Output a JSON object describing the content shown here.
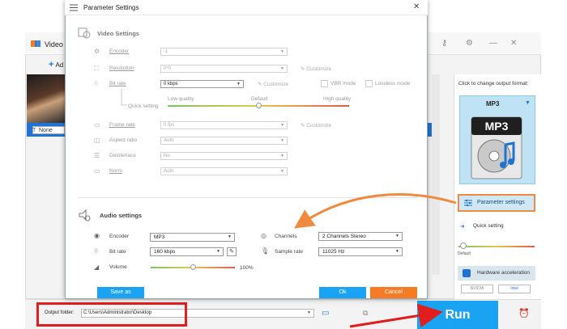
{
  "app": {
    "title": "Video C",
    "add_label": "Ad",
    "none_label": "None"
  },
  "dialog": {
    "title": "Parameter Settings",
    "video_section_title": "Video Settings",
    "video_rows": {
      "encoder": {
        "label": "Encoder",
        "value": "-1"
      },
      "resolution": {
        "label": "Resolution",
        "value": "0*0",
        "customize": "Customize"
      },
      "bitrate": {
        "label": "Bit rate",
        "value": "0 kbps",
        "customize": "Customize",
        "vbr": "VBR mode",
        "lossless": "Lossless mode"
      },
      "quick_setting": {
        "label": "Quick setting",
        "low": "Low quality",
        "default": "Default",
        "high": "High quality",
        "level": 0.5
      },
      "frame_rate": {
        "label": "Frame rate",
        "value": "0 fps",
        "customize": "Customize"
      },
      "aspect_ratio": {
        "label": "Aspect ratio",
        "value": "Auto"
      },
      "deinterlace": {
        "label": "Deinterlace",
        "value": "No"
      },
      "norm": {
        "label": "Norm",
        "value": "Auto"
      }
    },
    "audio_section_title": "Audio settings",
    "audio_rows": {
      "encoder": {
        "label": "Encoder",
        "value": "MP3"
      },
      "bitrate": {
        "label": "Bit rate",
        "value": "160 kbps"
      },
      "volume": {
        "label": "Volume",
        "value": "100%",
        "level": 0.5
      },
      "channels": {
        "label": "Channels",
        "value": "2 Channels Stereo"
      },
      "sample_rate": {
        "label": "Sample rate",
        "value": "11025 Hz"
      }
    },
    "buttons": {
      "save_as": "Save as",
      "ok": "Ok",
      "cancel": "Cancel"
    }
  },
  "right_panel": {
    "title": "Click to change output format:",
    "format": "MP3",
    "format_icon_text": "MP3",
    "param_button": "Parameter settings",
    "quick_setting": "Quick setting",
    "default_label": "Default",
    "hw_label": "Hardware acceleration",
    "nvidia": "NVIDIA",
    "intel": "Intel"
  },
  "bottom": {
    "output_label": "Output folder:",
    "output_path": "C:\\Users\\Administrator\\Desktop",
    "run_label": "Run"
  },
  "colors": {
    "accent": "#19a3f2",
    "highlight_orange": "#f08a3e",
    "highlight_red": "#e11d1d",
    "cancel": "#f57c24"
  }
}
